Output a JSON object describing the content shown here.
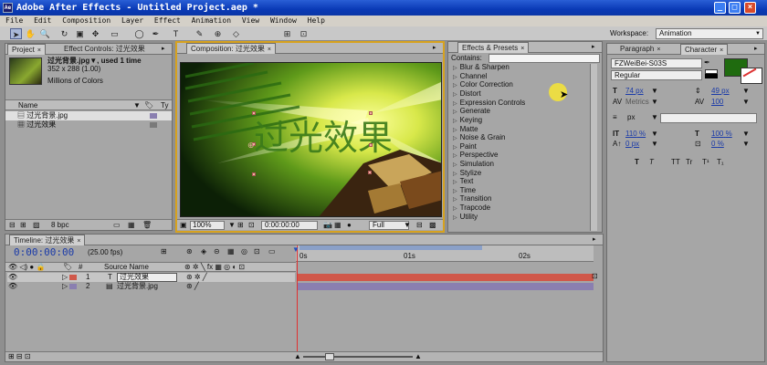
{
  "window": {
    "title": "Adobe After Effects - Untitled Project.aep *",
    "app_icon": "Ae",
    "min": "_",
    "max": "□",
    "close": "×"
  },
  "menu": [
    "File",
    "Edit",
    "Composition",
    "Layer",
    "Effect",
    "Animation",
    "View",
    "Window",
    "Help"
  ],
  "toolbar": {
    "workspace_label": "Workspace:",
    "workspace_value": "Animation",
    "tools": [
      "selection-tool",
      "hand-tool",
      "zoom-tool",
      "rotate-tool",
      "camera-tool",
      "pan-behind-tool",
      "mask-tool",
      "pen-tool",
      "type-tool",
      "brush-tool",
      "clone-tool",
      "eraser-tool",
      "puppet-tool"
    ]
  },
  "project_panel": {
    "tabs": [
      "Project",
      "Effect Controls: 过光效果"
    ],
    "selected_name": "过光背景.jpg",
    "selected_info": "▼, used 1 time",
    "dimensions": "352 x 288 (1.00)",
    "colors": "Millions of Colors",
    "col_name": "Name",
    "col_type": "Ty",
    "items": [
      {
        "name": "过光背景.jpg",
        "icon": "image-icon"
      },
      {
        "name": "过光效果",
        "icon": "composition-icon"
      }
    ],
    "bpc": "8 bpc"
  },
  "comp_panel": {
    "tab": "Composition: 过光效果",
    "zoom": "100%",
    "timecode": "0:00:00:00",
    "resolution": "Full",
    "title_text": "过光效果"
  },
  "effects_panel": {
    "tab": "Effects & Presets",
    "contains_label": "Contains:",
    "items": [
      "Blur & Sharpen",
      "Channel",
      "Color Correction",
      "Distort",
      "Expression Controls",
      "Generate",
      "Keying",
      "Matte",
      "Noise & Grain",
      "Paint",
      "Perspective",
      "Simulation",
      "Stylize",
      "Text",
      "Time",
      "Transition",
      "Trapcode",
      "Utility"
    ]
  },
  "character_panel": {
    "tabs": [
      "Paragraph",
      "Character"
    ],
    "font": "FZWeiBei-S03S",
    "style": "Regular",
    "font_size": "74",
    "font_size_unit": "px",
    "leading": "49",
    "leading_unit": "px",
    "kerning": "Metrics",
    "tracking": "100",
    "stroke_width_unit": "px",
    "vscale": "110",
    "hscale": "100",
    "vscale_unit": "%",
    "hscale_unit": "%",
    "baseline": "0",
    "baseline_unit": "px",
    "tsume": "0",
    "tsume_unit": "%",
    "fill_color": "#1f6b0f",
    "text_styles": [
      "T",
      "T",
      "TT",
      "Tr",
      "T¹",
      "T₁"
    ]
  },
  "timeline": {
    "tab": "Timeline: 过光效果",
    "timecode": "0:00:00:00",
    "fps": "(25.00 fps)",
    "col_num": "#",
    "col_source": "Source Name",
    "ruler": [
      "0s",
      "01s",
      "02s"
    ],
    "layers": [
      {
        "num": "1",
        "type_icon": "T",
        "name": "过光效果",
        "color": "#d0584a"
      },
      {
        "num": "2",
        "type_icon": "img",
        "name": "过光背景.jpg",
        "color": "#8a7fb0"
      }
    ]
  }
}
